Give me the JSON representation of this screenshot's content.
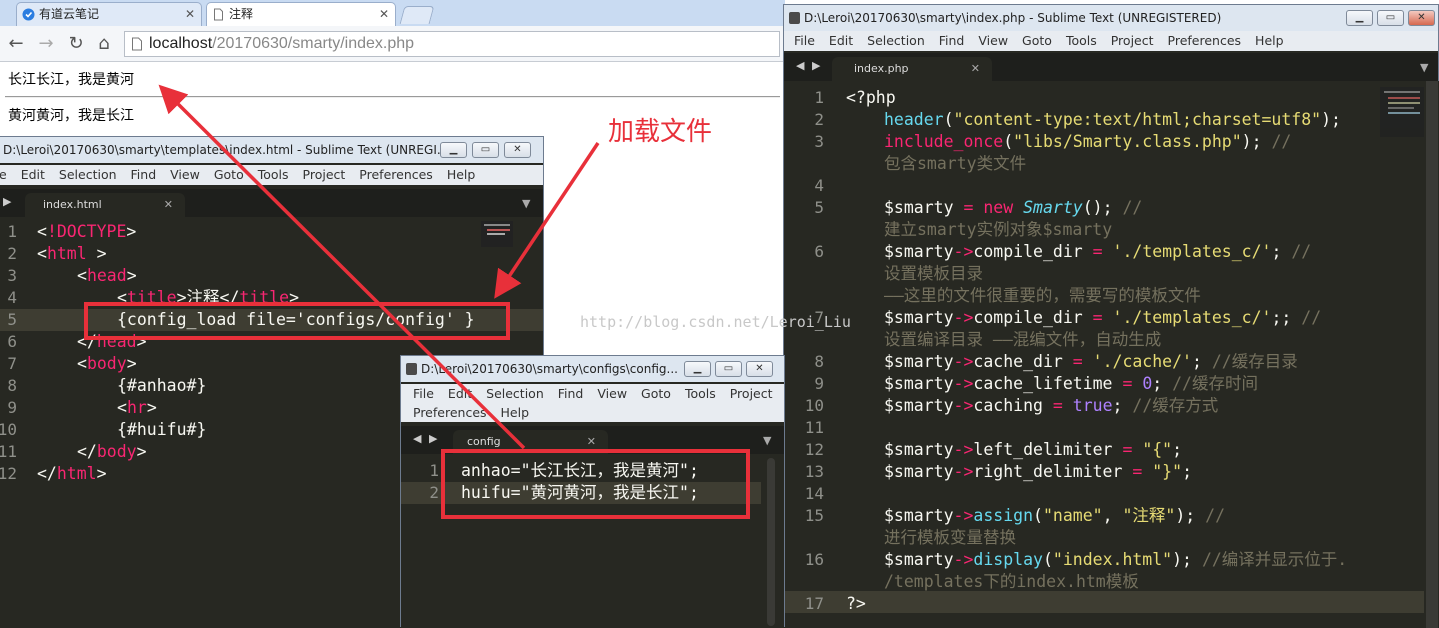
{
  "browser": {
    "tabs": [
      {
        "label": "有道云笔记",
        "icon": "youdao-note-icon"
      },
      {
        "label": "注释",
        "icon": "page-icon"
      }
    ],
    "address": {
      "host": "localhost",
      "path": "/20170630/smarty/index.php"
    },
    "page_lines": [
      "长江长江，我是黄河",
      "黄河黄河，我是长江"
    ]
  },
  "win_html": {
    "title": "D:\\Leroi\\20170630\\smarty\\templates\\index.html - Sublime Text (UNREGI...",
    "menu": [
      "e",
      "Edit",
      "Selection",
      "Find",
      "View",
      "Goto",
      "Tools",
      "Project",
      "Preferences",
      "Help"
    ],
    "tab": "index.html",
    "line_numbers": [
      "1",
      "2",
      "3",
      "4",
      "5",
      "6",
      "7",
      "8",
      "9",
      "10",
      "11",
      "12"
    ]
  },
  "win_config": {
    "title": "D:\\Leroi\\20170630\\smarty\\configs\\config...",
    "menu_row1": [
      "File",
      "Edit",
      "Selection",
      "Find",
      "View",
      "Goto",
      "Tools",
      "Project"
    ],
    "menu_row2": [
      "Preferences",
      "Help"
    ],
    "tab": "config",
    "line_numbers": [
      "1",
      "2"
    ]
  },
  "win_php": {
    "title": "D:\\Leroi\\20170630\\smarty\\index.php - Sublime Text (UNREGISTERED)",
    "menu": [
      "File",
      "Edit",
      "Selection",
      "Find",
      "View",
      "Goto",
      "Tools",
      "Project",
      "Preferences",
      "Help"
    ],
    "tab": "index.php",
    "line_numbers": [
      "1",
      "2",
      "3",
      "",
      "4",
      "5",
      "",
      "6",
      "",
      "",
      "7",
      "",
      "8",
      "9",
      "10",
      "11",
      "12",
      "13",
      "14",
      "15",
      "",
      "16",
      "",
      "17"
    ]
  },
  "annotation": {
    "label": "加载文件"
  },
  "watermark": "http://blog.csdn.net/Leroi_Liu",
  "colors": {
    "annotation": "#e8303a",
    "editor_bg": "#272822"
  }
}
